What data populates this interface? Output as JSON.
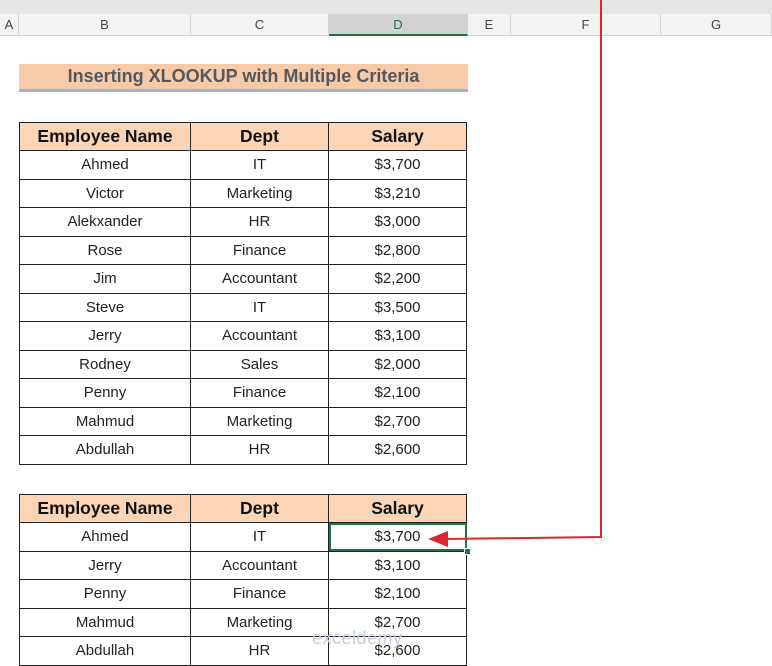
{
  "sheet": {
    "columns": [
      "A",
      "B",
      "C",
      "D",
      "E",
      "F",
      "G"
    ],
    "selected_column": "D"
  },
  "title": "Inserting XLOOKUP with Multiple Criteria",
  "table1": {
    "headers": [
      "Employee Name",
      "Dept",
      "Salary"
    ],
    "rows": [
      [
        "Ahmed",
        "IT",
        "$3,700"
      ],
      [
        "Victor",
        "Marketing",
        "$3,210"
      ],
      [
        "Alekxander",
        "HR",
        "$3,000"
      ],
      [
        "Rose",
        "Finance",
        "$2,800"
      ],
      [
        "Jim",
        "Accountant",
        "$2,200"
      ],
      [
        "Steve",
        "IT",
        "$3,500"
      ],
      [
        "Jerry",
        "Accountant",
        "$3,100"
      ],
      [
        "Rodney",
        "Sales",
        "$2,000"
      ],
      [
        "Penny",
        "Finance",
        "$2,100"
      ],
      [
        "Mahmud",
        "Marketing",
        "$2,700"
      ],
      [
        "Abdullah",
        "HR",
        "$2,600"
      ]
    ]
  },
  "table2": {
    "headers": [
      "Employee Name",
      "Dept",
      "Salary"
    ],
    "rows": [
      [
        "Ahmed",
        "IT",
        "$3,700"
      ],
      [
        "Jerry",
        "Accountant",
        "$3,100"
      ],
      [
        "Penny",
        "Finance",
        "$2,100"
      ],
      [
        "Mahmud",
        "Marketing",
        "$2,700"
      ],
      [
        "Abdullah",
        "HR",
        "$2,600"
      ]
    ]
  },
  "arrow_color": "#d9272e",
  "selection_color": "#217346",
  "watermark": "exceldemy"
}
